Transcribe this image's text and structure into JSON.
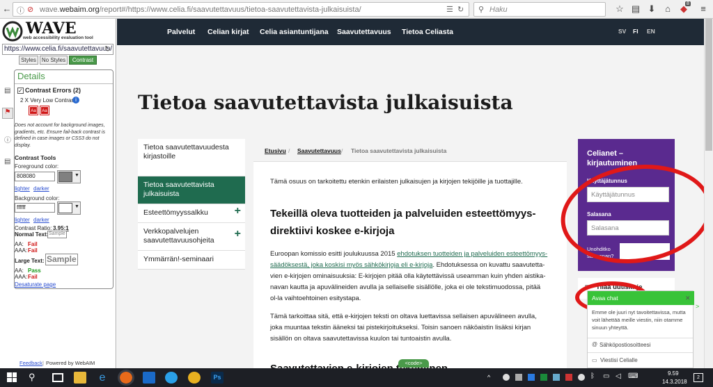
{
  "browser": {
    "url_prefix": "wave.",
    "url_domain": "webaim.org",
    "url_rest": "/report#/https://www.celia.fi/saavutettavuus/tietoa-saavutettavista-julkaisuista/",
    "search_placeholder": "Haku",
    "addon_badge": "8"
  },
  "wave": {
    "logo_title": "WAVE",
    "logo_subtitle": "web accessibility evaluation tool",
    "url": "https://www.celia.fi/saavutettavuus/",
    "tabs": [
      "Styles",
      "No Styles",
      "Contrast"
    ],
    "details_title": "Details",
    "contrast_errors": "Contrast Errors (2)",
    "very_low": "2 X Very Low Contrast",
    "error_icon": "Aa",
    "note": "Does not account for background images, gradients, etc. Ensure fail-back contrast is defined in case images or CSS3 do not display.",
    "tools_title": "Contrast Tools",
    "fg_label": "Foreground color:",
    "fg_value": "808080",
    "fg_color": "#808080",
    "lighter": "lighter",
    "darker": "darker",
    "bg_label": "Background color:",
    "bg_value": "ffffff",
    "bg_color": "#ffffff",
    "ratio_label": "Contrast Ratio:",
    "ratio": "3.95:1",
    "normal_text": "Normal Text:",
    "sample": "Sample",
    "aa": "AA:",
    "aaa": "AAA:",
    "fail": "Fail",
    "pass": "Pass",
    "large_text": "Large Text:",
    "desaturate": "Desaturate page",
    "feedback": "Feedback",
    "powered": "Powered by WebAIM"
  },
  "nav": {
    "items": [
      "Palvelut",
      "Celian kirjat",
      "Celia asiantuntijana",
      "Saavutettavuus",
      "Tietoa Celiasta"
    ],
    "langs": [
      "SV",
      "FI",
      "EN"
    ]
  },
  "page": {
    "title": "Tietoa saavutettavista julkaisuista",
    "sidebar": [
      "Tietoa saavutettavuudesta kirjastoille",
      "Tietoa saavutettavista julkaisuista",
      "Esteettömyyssalkku",
      "Verkkopalvelujen saavutettavuusohjeita",
      "Ymmärrän!-seminaari"
    ],
    "plus": "+",
    "breadcrumb": [
      "Etusivu",
      "Saavutettavuus",
      "Tietoa saavutettavista julkaisuista"
    ],
    "crumb_sep": "/",
    "intro": "Tämä osuus on tarkoitettu etenkin erilaisten julkaisujen ja kirjojen tekijöille ja tuottajille.",
    "h2": "Tekeillä oleva tuotteiden ja palveluiden esteettömyys-direktiivi koskee e-kirjoja",
    "p1_a": "Euroopan komissio esitti joulukuussa 2015 ",
    "p1_link": "ehdotuksen tuotteiden ja palveluiden esteettömyys-säädöksestä, joka koskisi myös sähkökirjoja eli e-kirjoja",
    "p1_b": ". Ehdotuksessa on kuvattu saavutetta-vien e-kirjojen ominaisuuksia: E-kirjojen pitää olla käytettävissä useamman kuin yhden aistika-navan kautta ja apuvälineiden avulla ja sellaiselle sisällölle, joka ei ole tekstimuodossa, pitää ol-la vaihtoehtoinen esitystapa.",
    "p2": "Tämä tarkoittaa sitä, että e-kirjojen teksti on oltava luettavissa sellaisen apuvälineen avulla, joka muuntaa tekstin ääneksi tai pistekirjoitukseksi. Toisin sanoen näköaistin lisäksi kirjan sisällön on oltava saavutettavissa kuulon tai tuntoaistin avulla.",
    "h2b": "Saavutettavien e-kirjojen tekeminen",
    "code_tag": "<code>"
  },
  "login": {
    "title": "Celianet – kirjautuminen",
    "user_label": "Käyttäjätunnus",
    "user_placeholder": "Käyttäjätunnus",
    "pw_label": "Salasana",
    "pw_placeholder": "Salasana",
    "forgot": "Unohditko salasanan?",
    "order": "Tilaa uutiskirje"
  },
  "chat": {
    "button": "Avaa chat",
    "close": "✕",
    "message": "Emme ole juuri nyt tavoitettavissa, mutta voit lähettää meille viestin, niin otamme sinuun yhteyttä.",
    "email": "Sähköpostiosoitteesi",
    "msg": "Viestisi Celialle"
  },
  "taskbar": {
    "time": "9.59",
    "date": "14.3.2018",
    "notif": "2"
  }
}
